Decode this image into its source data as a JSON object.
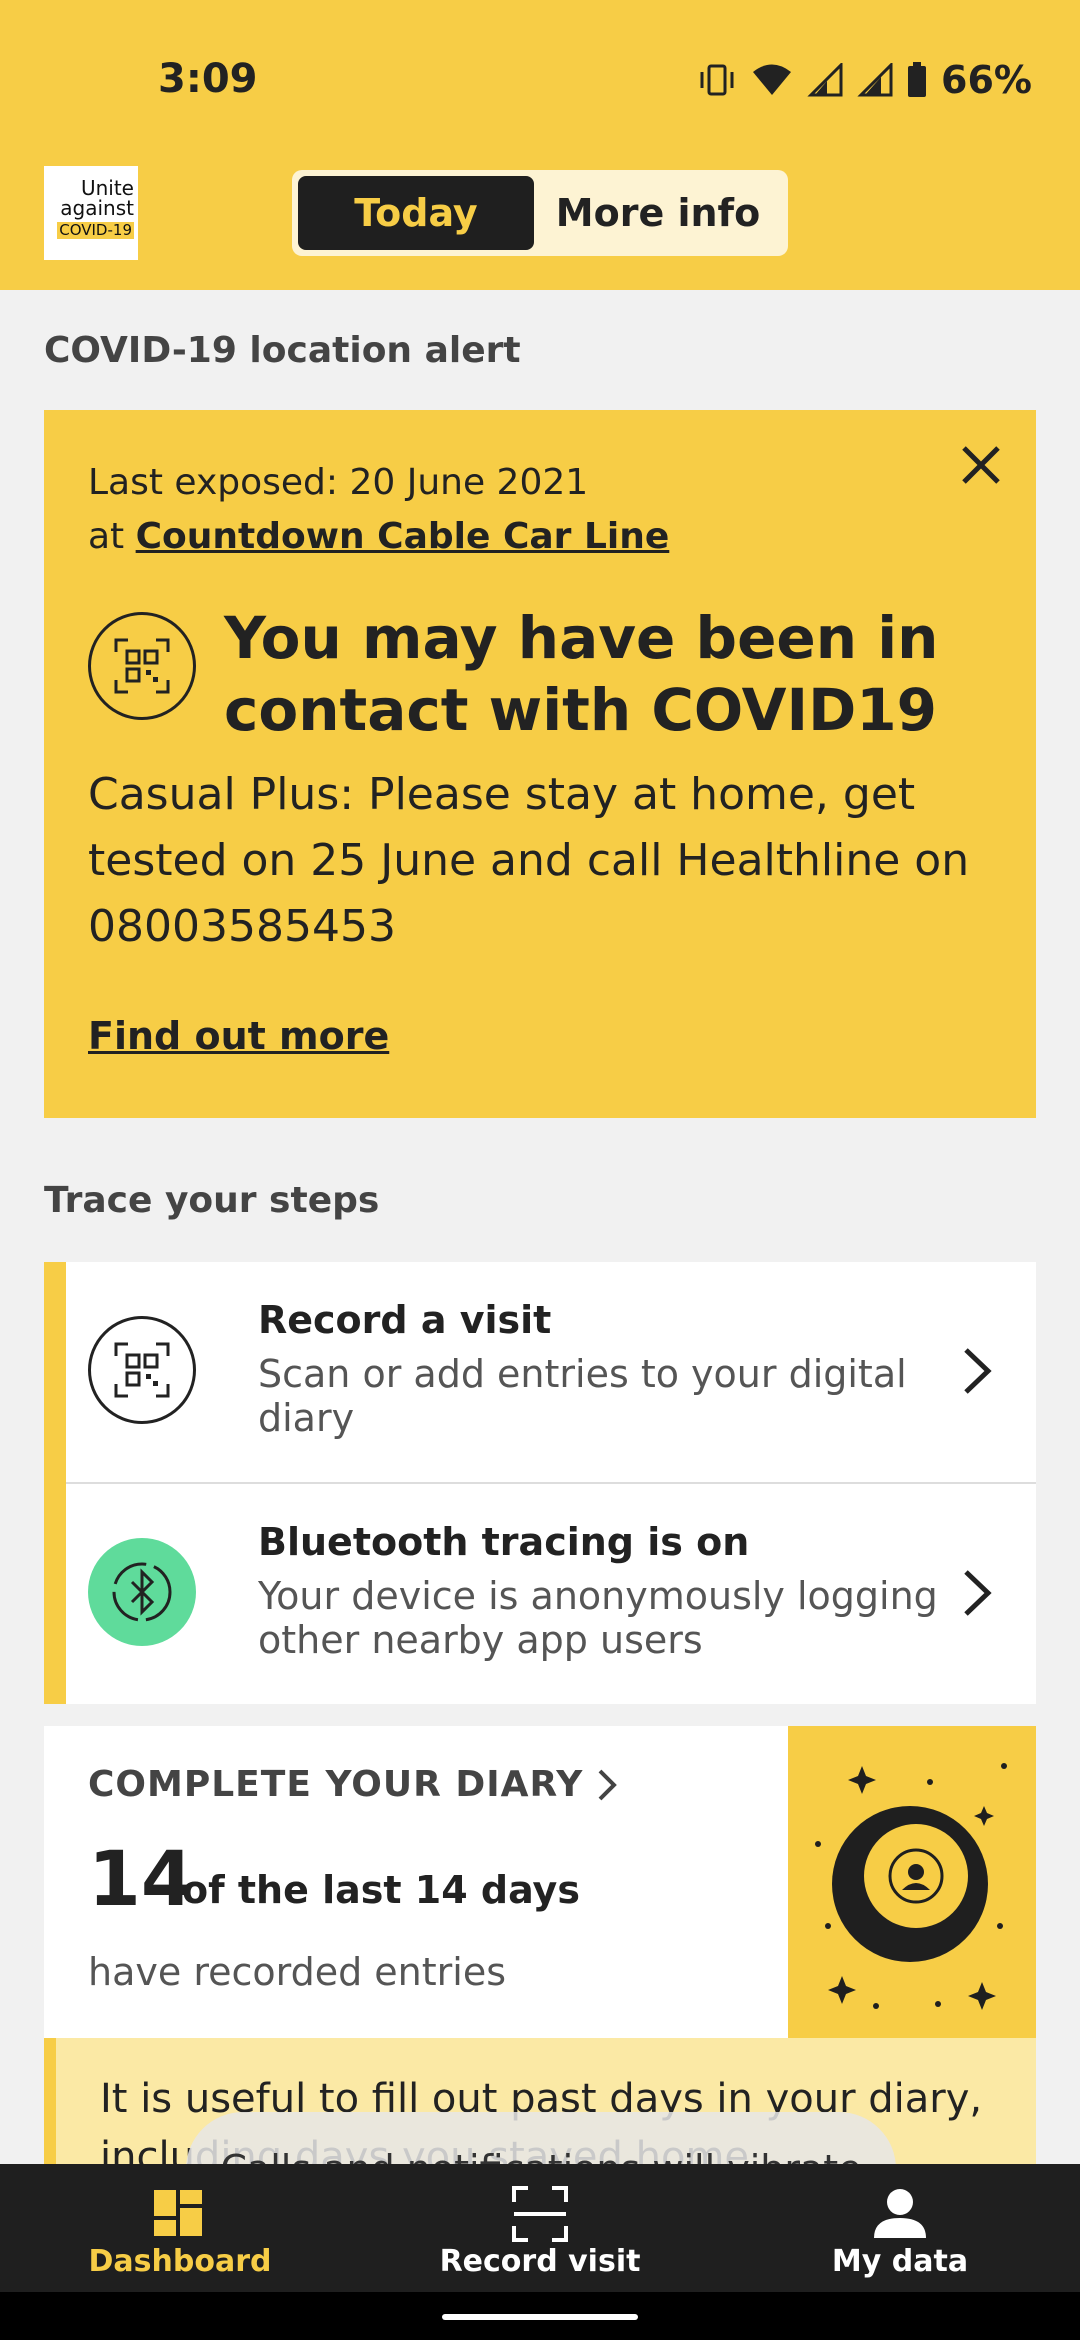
{
  "status": {
    "time": "3:09",
    "battery": "66%"
  },
  "header": {
    "logo": {
      "line1": "Unite",
      "line2": "against",
      "line3": "COVID-19"
    },
    "tabs": [
      "Today",
      "More info"
    ],
    "active_tab": "Today"
  },
  "alert": {
    "section_title": "COVID-19 location alert",
    "exposed_label": "Last exposed: 20 June 2021",
    "at_label": "at",
    "place": "Countdown Cable Car Line",
    "heading": "You may have been in contact with COVID19",
    "body": "Casual Plus: Please stay at home, get tested on 25 June and call Healthline on 08003585453",
    "link": "Find out more"
  },
  "steps": {
    "section_title": "Trace your steps",
    "items": [
      {
        "title": "Record a visit",
        "desc": "Scan or add entries to your digital diary",
        "icon": "qr-code-icon"
      },
      {
        "title": "Bluetooth tracing is on",
        "desc": "Your device is anonymously logging other nearby app users",
        "icon": "bluetooth-icon"
      }
    ]
  },
  "diary": {
    "heading": "COMPLETE YOUR DIARY",
    "count": "14",
    "count_suffix": "of the last 14 days",
    "sub": "have recorded entries"
  },
  "tip": {
    "text": "It is useful to fill out past days in your diary, including days you stayed home."
  },
  "toast": {
    "text": "Calls and notifications will vibrate"
  },
  "nav": [
    {
      "label": "Dashboard",
      "icon": "dashboard-icon",
      "active": true
    },
    {
      "label": "Record visit",
      "icon": "scan-icon",
      "active": false
    },
    {
      "label": "My data",
      "icon": "person-icon",
      "active": false
    }
  ],
  "colors": {
    "brand_yellow": "#f7cd46",
    "dark": "#1f1f1f",
    "bluetooth_green": "#5fdb9b"
  }
}
